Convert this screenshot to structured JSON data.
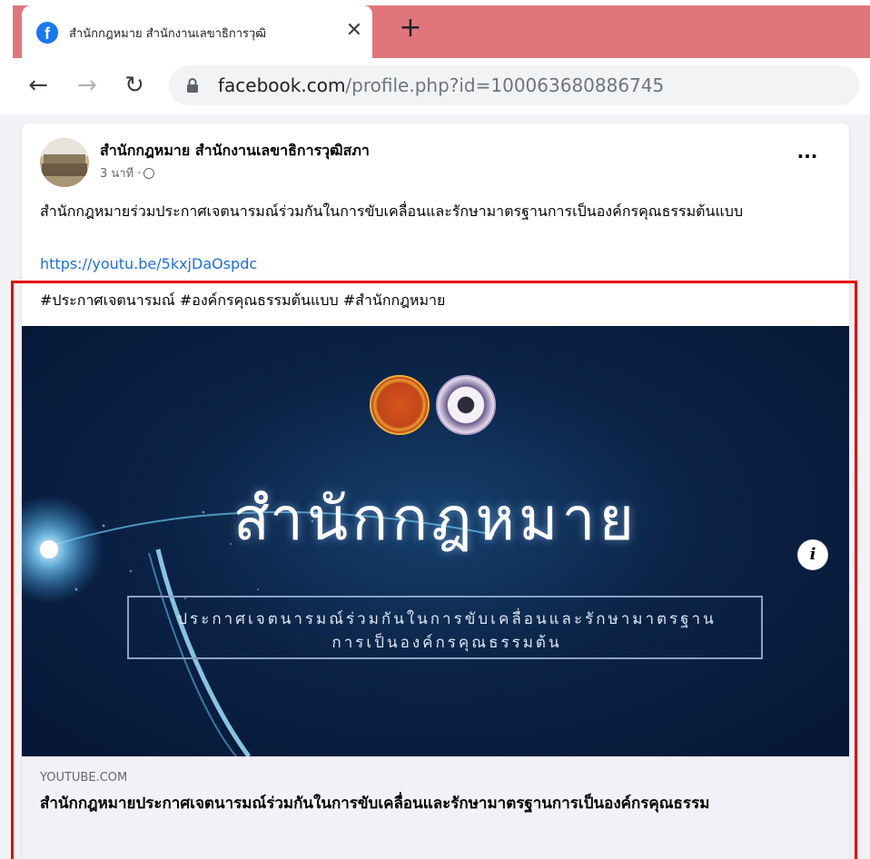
{
  "browser": {
    "tab_title": "สำนักกฎหมาย สำนักงานเลขาธิการวุฒิ",
    "tab_close": "✕",
    "new_tab": "+",
    "nav_back": "←",
    "nav_forward": "→",
    "nav_reload": "↻",
    "url_domain": "facebook.com",
    "url_path": "/profile.php?id=100063680886745",
    "accent_color": "#e0767c"
  },
  "post": {
    "author": "สำนักกฎหมาย สำนักงานเลขาธิการวุฒิสภา",
    "time": "3 นาที ·",
    "more": "···",
    "text": "สำนักกฎหมายร่วมประกาศเจตนารมณ์ร่วมกันในการขับเคลื่อนและรักษามาตรฐานการเป็นองค์กรคุณธรรมต้นแบบ",
    "link": "https://youtu.be/5kxjDaOspdc",
    "hashtags": [
      "#ประกาศเจตนารมณ์",
      "#องค์กรคุณธรรมต้นแบบ",
      "#สำนักกฎหมาย"
    ]
  },
  "preview": {
    "title": "สำนักกฎหมาย",
    "line1": "ประกาศเจตนารมณ์ร่วมกันในการขับเคลื่อนและรักษามาตรฐาน",
    "line2": "การเป็นองค์กรคุณธรรมต้น",
    "info": "i"
  },
  "link_card": {
    "domain": "YOUTUBE.COM",
    "title": "สำนักกฎหมายประกาศเจตนารมณ์ร่วมกันในการขับเคลื่อนและรักษามาตรฐานการเป็นองค์กรคุณธรรม"
  },
  "colors": {
    "highlight": "#e60000",
    "link": "#216fdb",
    "facebook": "#1877f2"
  }
}
